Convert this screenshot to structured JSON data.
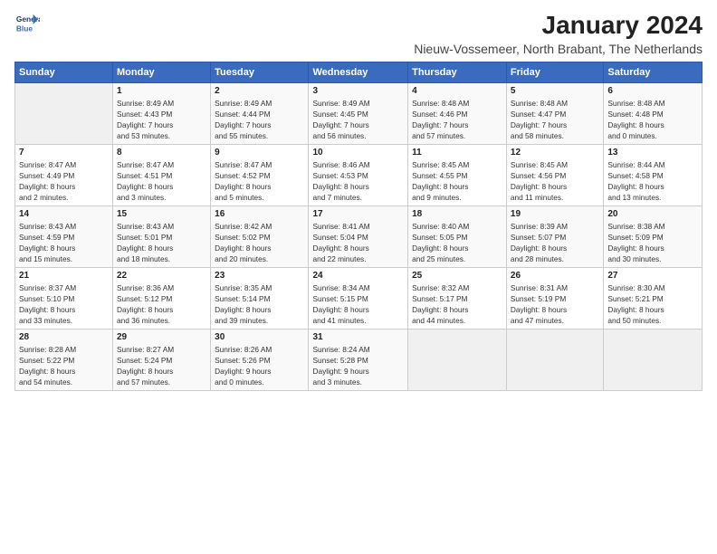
{
  "header": {
    "logo_line1": "General",
    "logo_line2": "Blue",
    "title": "January 2024",
    "subtitle": "Nieuw-Vossemeer, North Brabant, The Netherlands"
  },
  "days_of_week": [
    "Sunday",
    "Monday",
    "Tuesday",
    "Wednesday",
    "Thursday",
    "Friday",
    "Saturday"
  ],
  "weeks": [
    [
      {
        "day": "",
        "content": ""
      },
      {
        "day": "1",
        "content": "Sunrise: 8:49 AM\nSunset: 4:43 PM\nDaylight: 7 hours\nand 53 minutes."
      },
      {
        "day": "2",
        "content": "Sunrise: 8:49 AM\nSunset: 4:44 PM\nDaylight: 7 hours\nand 55 minutes."
      },
      {
        "day": "3",
        "content": "Sunrise: 8:49 AM\nSunset: 4:45 PM\nDaylight: 7 hours\nand 56 minutes."
      },
      {
        "day": "4",
        "content": "Sunrise: 8:48 AM\nSunset: 4:46 PM\nDaylight: 7 hours\nand 57 minutes."
      },
      {
        "day": "5",
        "content": "Sunrise: 8:48 AM\nSunset: 4:47 PM\nDaylight: 7 hours\nand 58 minutes."
      },
      {
        "day": "6",
        "content": "Sunrise: 8:48 AM\nSunset: 4:48 PM\nDaylight: 8 hours\nand 0 minutes."
      }
    ],
    [
      {
        "day": "7",
        "content": "Sunrise: 8:47 AM\nSunset: 4:49 PM\nDaylight: 8 hours\nand 2 minutes."
      },
      {
        "day": "8",
        "content": "Sunrise: 8:47 AM\nSunset: 4:51 PM\nDaylight: 8 hours\nand 3 minutes."
      },
      {
        "day": "9",
        "content": "Sunrise: 8:47 AM\nSunset: 4:52 PM\nDaylight: 8 hours\nand 5 minutes."
      },
      {
        "day": "10",
        "content": "Sunrise: 8:46 AM\nSunset: 4:53 PM\nDaylight: 8 hours\nand 7 minutes."
      },
      {
        "day": "11",
        "content": "Sunrise: 8:45 AM\nSunset: 4:55 PM\nDaylight: 8 hours\nand 9 minutes."
      },
      {
        "day": "12",
        "content": "Sunrise: 8:45 AM\nSunset: 4:56 PM\nDaylight: 8 hours\nand 11 minutes."
      },
      {
        "day": "13",
        "content": "Sunrise: 8:44 AM\nSunset: 4:58 PM\nDaylight: 8 hours\nand 13 minutes."
      }
    ],
    [
      {
        "day": "14",
        "content": "Sunrise: 8:43 AM\nSunset: 4:59 PM\nDaylight: 8 hours\nand 15 minutes."
      },
      {
        "day": "15",
        "content": "Sunrise: 8:43 AM\nSunset: 5:01 PM\nDaylight: 8 hours\nand 18 minutes."
      },
      {
        "day": "16",
        "content": "Sunrise: 8:42 AM\nSunset: 5:02 PM\nDaylight: 8 hours\nand 20 minutes."
      },
      {
        "day": "17",
        "content": "Sunrise: 8:41 AM\nSunset: 5:04 PM\nDaylight: 8 hours\nand 22 minutes."
      },
      {
        "day": "18",
        "content": "Sunrise: 8:40 AM\nSunset: 5:05 PM\nDaylight: 8 hours\nand 25 minutes."
      },
      {
        "day": "19",
        "content": "Sunrise: 8:39 AM\nSunset: 5:07 PM\nDaylight: 8 hours\nand 28 minutes."
      },
      {
        "day": "20",
        "content": "Sunrise: 8:38 AM\nSunset: 5:09 PM\nDaylight: 8 hours\nand 30 minutes."
      }
    ],
    [
      {
        "day": "21",
        "content": "Sunrise: 8:37 AM\nSunset: 5:10 PM\nDaylight: 8 hours\nand 33 minutes."
      },
      {
        "day": "22",
        "content": "Sunrise: 8:36 AM\nSunset: 5:12 PM\nDaylight: 8 hours\nand 36 minutes."
      },
      {
        "day": "23",
        "content": "Sunrise: 8:35 AM\nSunset: 5:14 PM\nDaylight: 8 hours\nand 39 minutes."
      },
      {
        "day": "24",
        "content": "Sunrise: 8:34 AM\nSunset: 5:15 PM\nDaylight: 8 hours\nand 41 minutes."
      },
      {
        "day": "25",
        "content": "Sunrise: 8:32 AM\nSunset: 5:17 PM\nDaylight: 8 hours\nand 44 minutes."
      },
      {
        "day": "26",
        "content": "Sunrise: 8:31 AM\nSunset: 5:19 PM\nDaylight: 8 hours\nand 47 minutes."
      },
      {
        "day": "27",
        "content": "Sunrise: 8:30 AM\nSunset: 5:21 PM\nDaylight: 8 hours\nand 50 minutes."
      }
    ],
    [
      {
        "day": "28",
        "content": "Sunrise: 8:28 AM\nSunset: 5:22 PM\nDaylight: 8 hours\nand 54 minutes."
      },
      {
        "day": "29",
        "content": "Sunrise: 8:27 AM\nSunset: 5:24 PM\nDaylight: 8 hours\nand 57 minutes."
      },
      {
        "day": "30",
        "content": "Sunrise: 8:26 AM\nSunset: 5:26 PM\nDaylight: 9 hours\nand 0 minutes."
      },
      {
        "day": "31",
        "content": "Sunrise: 8:24 AM\nSunset: 5:28 PM\nDaylight: 9 hours\nand 3 minutes."
      },
      {
        "day": "",
        "content": ""
      },
      {
        "day": "",
        "content": ""
      },
      {
        "day": "",
        "content": ""
      }
    ]
  ]
}
